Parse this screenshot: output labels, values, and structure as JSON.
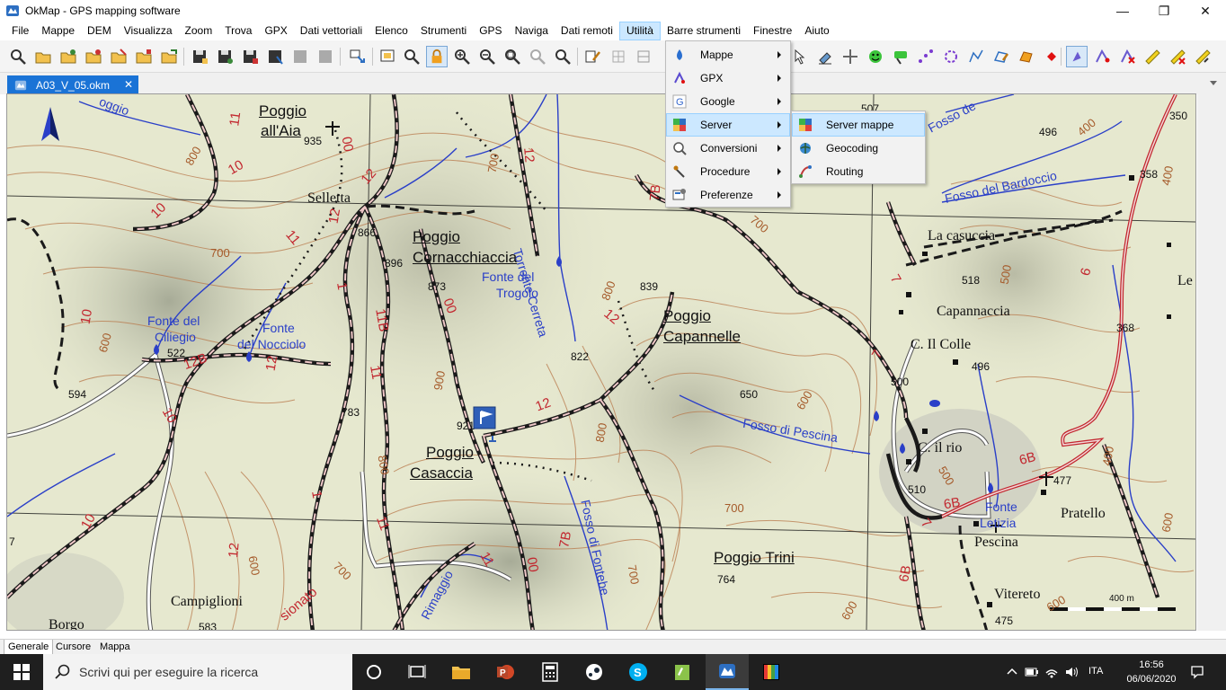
{
  "window": {
    "title": "OkMap - GPS mapping software",
    "minimize": "—",
    "restore": "❐",
    "close": "✕"
  },
  "menubar": {
    "items": [
      "File",
      "Mappe",
      "DEM",
      "Visualizza",
      "Zoom",
      "Trova",
      "GPX",
      "Dati vettoriali",
      "Elenco",
      "Strumenti",
      "GPS",
      "Naviga",
      "Dati remoti",
      "Utilità",
      "Barre strumenti",
      "Finestre",
      "Aiuto"
    ],
    "open_item": "Utilità"
  },
  "utilita_menu": {
    "items": [
      {
        "label": "Mappe",
        "icon": "water-drop-icon",
        "submenu": true
      },
      {
        "label": "GPX",
        "icon": "gpx-arrow-icon",
        "submenu": true
      },
      {
        "label": "Google",
        "icon": "google-g-icon",
        "submenu": true
      },
      {
        "label": "Server",
        "icon": "server-icon",
        "submenu": true,
        "highlighted": true
      },
      {
        "label": "Conversioni",
        "icon": "conversion-icon",
        "submenu": true
      },
      {
        "label": "Procedure",
        "icon": "procedure-icon",
        "submenu": true
      },
      {
        "label": "Preferenze",
        "icon": "preferences-icon",
        "submenu": true
      }
    ]
  },
  "server_submenu": {
    "items": [
      {
        "label": "Server mappe",
        "icon": "server-maps-icon",
        "highlighted": true
      },
      {
        "label": "Geocoding",
        "icon": "geocoding-icon"
      },
      {
        "label": "Routing",
        "icon": "routing-icon"
      }
    ]
  },
  "document_tab": {
    "label": "A03_V_05.okm",
    "close": "✕"
  },
  "map": {
    "colors": {
      "background": "#e9ead0",
      "trail": "#c2262e",
      "water": "#2a3fc8",
      "contour": "#b8784a",
      "road": "#ffffff",
      "grid": "#1a1a1a",
      "waypoint_flag": "#2f5fb8"
    },
    "places": {
      "poggio_all_aia_1": "Poggio",
      "poggio_all_aia_2": "all'Aia",
      "selletta": "Selletta",
      "poggio_corn_1": "Poggio",
      "poggio_corn_2": "Cornacchiaccia",
      "poggio_cap_1": "Poggio",
      "poggio_cap_2": "Capannelle",
      "poggio_cas_1": "Poggio",
      "poggio_cas_2": "Casaccia",
      "poggio_trini": "Poggio Trini",
      "campiglioni": "Campiglioni",
      "borgo": "Borgo",
      "la_casuccia": "La casuccia",
      "capannaccia": "Capannaccia",
      "c_il_colle": "C. Il Colle",
      "c_il_rio": "C. il rio",
      "pratello": "Pratello",
      "pescina": "Pescina",
      "vitereto": "Vitereto",
      "le_ca": "Le Ca"
    },
    "water_labels": {
      "fonte_ciliegio_1": "Fonte del",
      "fonte_ciliegio_2": "Ciliegio",
      "fonte_nocciolo_1": "Fonte",
      "fonte_nocciolo_2": "del Nocciolo",
      "fonte_trogolo_1": "Fonte del",
      "fonte_trogolo_2": "Trogolo",
      "torrente": "Torrente Cerreta",
      "fosso_pescina": "Fosso di Pescina",
      "fosso_bardoccio": "Fosso del Bardoccio",
      "fosso_fontebe": "Fosso di Fontebe",
      "fonte_letizia_1": "Fonte",
      "fonte_letizia_2": "Letizia",
      "rimaggio": "Rimaggio",
      "fosso_top": "Fosso de",
      "top_left_water": "oggio"
    },
    "elevations": {
      "e935": "935",
      "e866": "866",
      "e896": "896",
      "e873": "873",
      "e839": "839",
      "e822": "822",
      "e522": "522",
      "e594": "594",
      "e783": "783",
      "e921": "921",
      "e650": "650",
      "e764": "764",
      "e583": "583",
      "e496a": "496",
      "e496b": "496",
      "e518": "518",
      "e500": "500",
      "e510": "510",
      "e477": "477",
      "e475": "475",
      "e368": "368",
      "e358": "358",
      "e350": "350",
      "e507": "507",
      "e7": "7"
    },
    "trail_numbers": {
      "t11a": "11",
      "t10a": "10",
      "t12a": "12",
      "t10b": "10",
      "t11b": "11",
      "t12b": "12",
      "t10c": "10",
      "t12B": "12B",
      "t12c": "12",
      "t1a": "1",
      "t11B": "11B",
      "t11c": "11",
      "t00a": "00",
      "t12d": "12",
      "t7Ba": "7B",
      "t12e": "12",
      "t12f": "12",
      "t10d": "10",
      "t1b": "1",
      "t11d": "11",
      "t12g": "12",
      "t11e": "11",
      "t00b": "00",
      "t7Bb": "7B",
      "t7a": "7",
      "t7b": "7",
      "t6Ba": "6B",
      "t6Bb": "6B",
      "t7c": "7",
      "t6": "6",
      "t6Bc": "6B",
      "t10e": "10",
      "t00c": "00"
    },
    "contour_labels": {
      "c800a": "800",
      "c700a": "700",
      "c600a": "600",
      "c900": "900",
      "c800b": "800",
      "c700b": "700",
      "c800c": "800",
      "c700c": "700",
      "c600b": "600",
      "c700d": "700",
      "c800d": "800",
      "c700e": "700",
      "c600c": "600",
      "c500a": "500",
      "c500b": "500",
      "c400a": "400",
      "c400b": "400",
      "c400c": "400",
      "c600d": "600",
      "c600e": "600",
      "c700f": "700",
      "c600f": "600"
    },
    "misc": {
      "sionato": "sionato",
      "scale_label": "400 m"
    }
  },
  "bottom_tabs": [
    "Generale",
    "Cursore",
    "Mappa"
  ],
  "taskbar": {
    "search_placeholder": "Scrivi qui per eseguire la ricerca",
    "language": "ITA",
    "time": "16:56",
    "date": "06/06/2020"
  }
}
